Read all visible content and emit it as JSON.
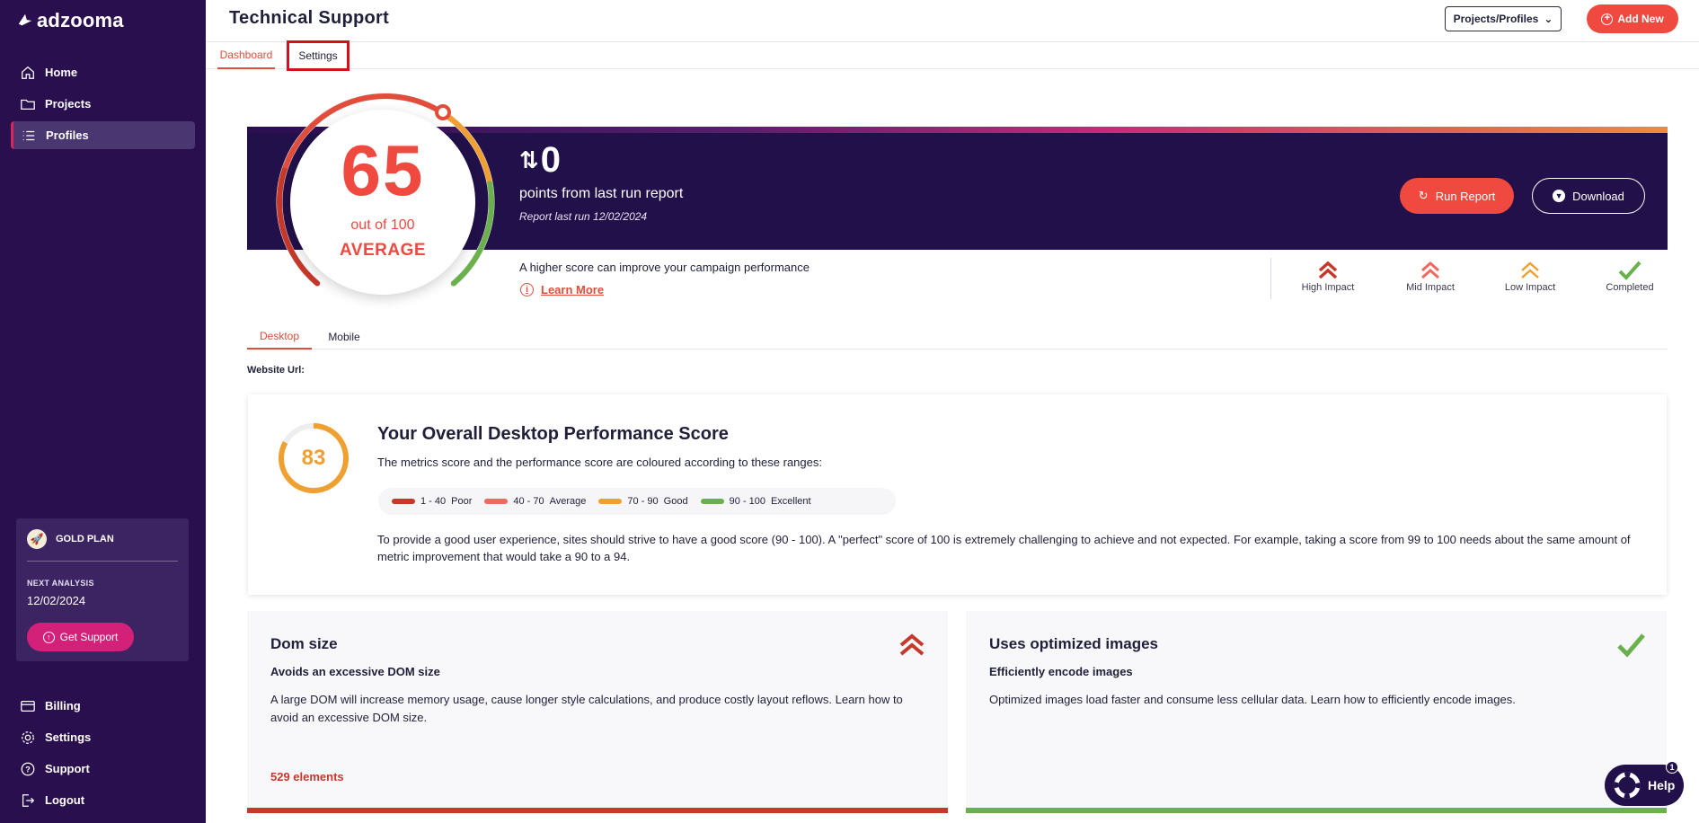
{
  "app": {
    "brand": "adzooma"
  },
  "sidebar": {
    "top_items": [
      {
        "label": "Home",
        "icon": "home-icon"
      },
      {
        "label": "Projects",
        "icon": "folder-icon"
      },
      {
        "label": "Profiles",
        "icon": "list-icon",
        "active": true
      }
    ],
    "plan": {
      "name": "GOLD PLAN",
      "next_label": "NEXT ANALYSIS",
      "next_date": "12/02/2024",
      "support_label": "Get Support"
    },
    "bottom_items": [
      {
        "label": "Billing",
        "icon": "billing-icon"
      },
      {
        "label": "Settings",
        "icon": "gear-icon"
      },
      {
        "label": "Support",
        "icon": "help-circle-icon"
      },
      {
        "label": "Logout",
        "icon": "logout-icon"
      }
    ]
  },
  "header": {
    "title": "Technical Support",
    "projects_select": "Projects/Profiles",
    "add_new": "Add New"
  },
  "subtabs": {
    "dashboard": "Dashboard",
    "settings": "Settings"
  },
  "score": {
    "value": "65",
    "out_of": "out of 100",
    "grade": "AVERAGE",
    "gauge_fraction": 0.65
  },
  "banner": {
    "delta": "0",
    "delta_label": "points from last run report",
    "last_run": "Report last run 12/02/2024",
    "run_report": "Run Report",
    "download": "Download"
  },
  "hint": "A higher score can improve your campaign performance",
  "learn_more": "Learn More",
  "impact_legend": [
    {
      "label": "High Impact",
      "color": "#c6382a"
    },
    {
      "label": "Mid Impact",
      "color": "#f0695f"
    },
    {
      "label": "Low Impact",
      "color": "#f0a030"
    },
    {
      "label": "Completed",
      "color": "#6ab04c"
    }
  ],
  "device_tabs": {
    "desktop": "Desktop",
    "mobile": "Mobile"
  },
  "website_url_label": "Website Url:",
  "performance": {
    "score": "83",
    "title": "Your Overall Desktop Performance Score",
    "subtitle": "The metrics score and the performance score are coloured according to these ranges:",
    "ranges": [
      {
        "range": "1 - 40",
        "label": "Poor",
        "color": "#c6382a"
      },
      {
        "range": "40 - 70",
        "label": "Average",
        "color": "#f0695f"
      },
      {
        "range": "70 - 90",
        "label": "Good",
        "color": "#f0a030"
      },
      {
        "range": "90 - 100",
        "label": "Excellent",
        "color": "#6ab04c"
      }
    ],
    "paragraph": "To provide a good user experience, sites should strive to have a good score (90 - 100). A \"perfect\" score of 100 is extremely challenging to achieve and not expected. For example, taking a score from 99 to 100 needs about the same amount of metric improvement that would take a 90 to a 94."
  },
  "audits": [
    {
      "title": "Dom size",
      "subtitle": "Avoids an excessive DOM size",
      "description": "A large DOM will increase memory usage, cause longer style calculations, and produce costly layout reflows. Learn how to avoid an excessive DOM size.",
      "metric": "529 elements",
      "impact_icon": "high-impact-icon",
      "bar_color": "#c6382a"
    },
    {
      "title": "Uses optimized images",
      "subtitle": "Efficiently encode images",
      "description": "Optimized images load faster and consume less cellular data. Learn how to efficiently encode images.",
      "metric": "",
      "impact_icon": "completed-check-icon",
      "bar_color": "#6ab04c"
    }
  ],
  "help": {
    "label": "Help",
    "badge": "1"
  }
}
